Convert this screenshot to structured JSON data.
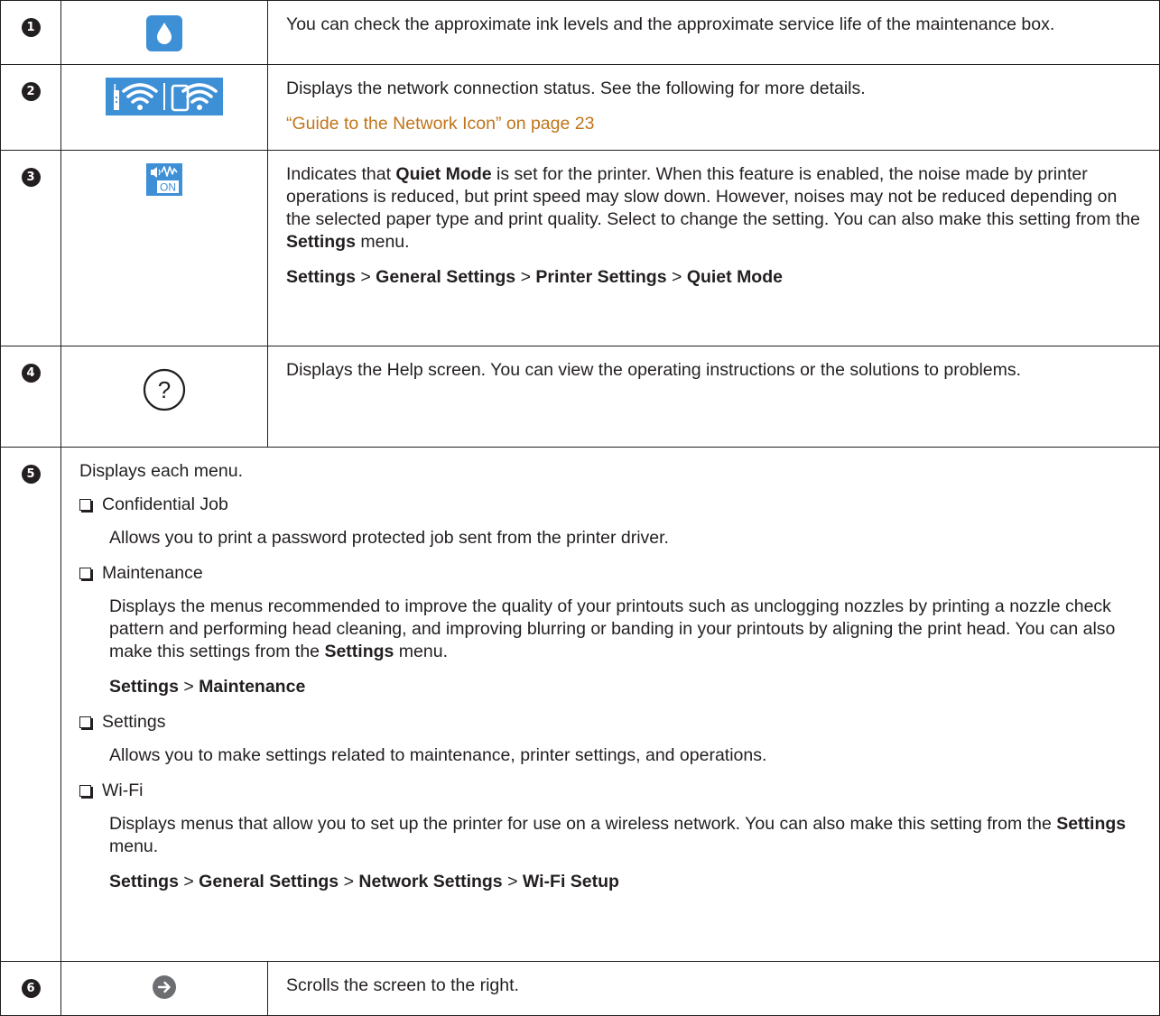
{
  "rows": [
    {
      "num": "1",
      "icon": "ink-drop-icon",
      "desc": "You can check the approximate ink levels and the approximate service life of the maintenance box."
    },
    {
      "num": "2",
      "icon": "network-status-icon",
      "desc": "Displays the network connection status. See the following for more details.",
      "link": "“Guide to the Network Icon” on page 23"
    },
    {
      "num": "3",
      "icon": "quiet-mode-on-icon",
      "icon_text": "ON",
      "desc_a": "Indicates that ",
      "desc_b": "Quiet Mode",
      "desc_c": " is set for the printer. When this feature is enabled, the noise made by printer operations is reduced, but print speed may slow down. However, noises may not be reduced depending on the selected paper type and print quality. Select to change the setting. You can also make this setting from the ",
      "desc_d": "Settings",
      "desc_e": " menu.",
      "path": [
        "Settings",
        "General Settings",
        "Printer Settings",
        "Quiet Mode"
      ]
    },
    {
      "num": "4",
      "icon": "help-icon",
      "icon_text": "?",
      "desc": "Displays the Help screen. You can view the operating instructions or the solutions to problems."
    },
    {
      "num": "5",
      "intro": "Displays each menu.",
      "items": [
        {
          "title": "Confidential Job",
          "text": "Allows you to print a password protected job sent from the printer driver."
        },
        {
          "title": "Maintenance",
          "text_a": "Displays the menus recommended to improve the quality of your printouts such as unclogging nozzles by printing a nozzle check pattern and performing head cleaning, and improving blurring or banding in your printouts by aligning the print head. You can also make this settings from the ",
          "text_b": "Settings",
          "text_c": " menu.",
          "path": [
            "Settings",
            "Maintenance"
          ]
        },
        {
          "title": "Settings",
          "text": "Allows you to make settings related to maintenance, printer settings, and operations."
        },
        {
          "title": "Wi-Fi",
          "text_a": "Displays menus that allow you to set up the printer for use on a wireless network. You can also make this setting from the ",
          "text_b": "Settings",
          "text_c": " menu.",
          "path": [
            "Settings",
            "General Settings",
            "Network Settings",
            "Wi-Fi Setup"
          ]
        }
      ]
    },
    {
      "num": "6",
      "icon": "arrow-right-icon",
      "desc": "Scrolls the screen to the right."
    }
  ],
  "path_sep": ">",
  "colors": {
    "link": "#c0751a",
    "icon_blue": "#3d8fd6",
    "text": "#231f20"
  }
}
